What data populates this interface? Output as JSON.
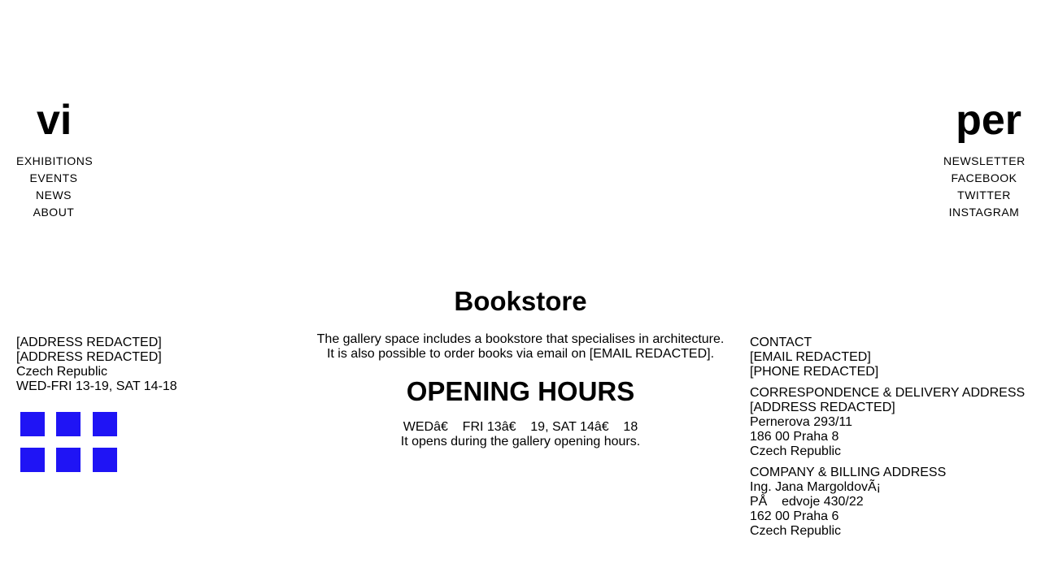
{
  "header": {
    "logo_left": "vi",
    "logo_right": "per"
  },
  "nav_left": [
    "EXHIBITIONS",
    "EVENTS",
    "NEWS",
    "ABOUT"
  ],
  "nav_right": [
    "NEWSLETTER",
    "FACEBOOK",
    "TWITTER",
    "INSTAGRAM"
  ],
  "left_info": {
    "lines": [
      "[ADDRESS REDACTED]",
      "[ADDRESS REDACTED]",
      "Czech Republic",
      "WED-FRI 13-19, SAT 14-18"
    ],
    "square_color": "#1f14f5",
    "square_count": 6
  },
  "main": {
    "bookstore_title": "Bookstore",
    "bookstore_text": [
      "The gallery space includes a bookstore that specialises in architecture.",
      "It is also possible to order books via email on [EMAIL REDACTED]."
    ],
    "hours_title": "OPENING HOURS",
    "hours_text": [
      "WEDâ€    FRI 13â€    19, SAT 14â€    18",
      "It opens during the gallery opening hours."
    ]
  },
  "right_info": {
    "contact": [
      "CONTACT",
      "[EMAIL REDACTED]",
      "[PHONE REDACTED]"
    ],
    "correspondence": [
      "CORRESPONDENCE & DELIVERY ADDRESS",
      "[ADDRESS REDACTED]",
      "Pernerova 293/11",
      "186 00 Praha 8",
      "Czech Republic"
    ],
    "billing": [
      "COMPANY & BILLING ADDRESS",
      "Ing. Jana MargoldovÃ¡",
      "PÅ    edvoje 430/22",
      "162 00 Praha 6",
      "Czech Republic"
    ]
  }
}
